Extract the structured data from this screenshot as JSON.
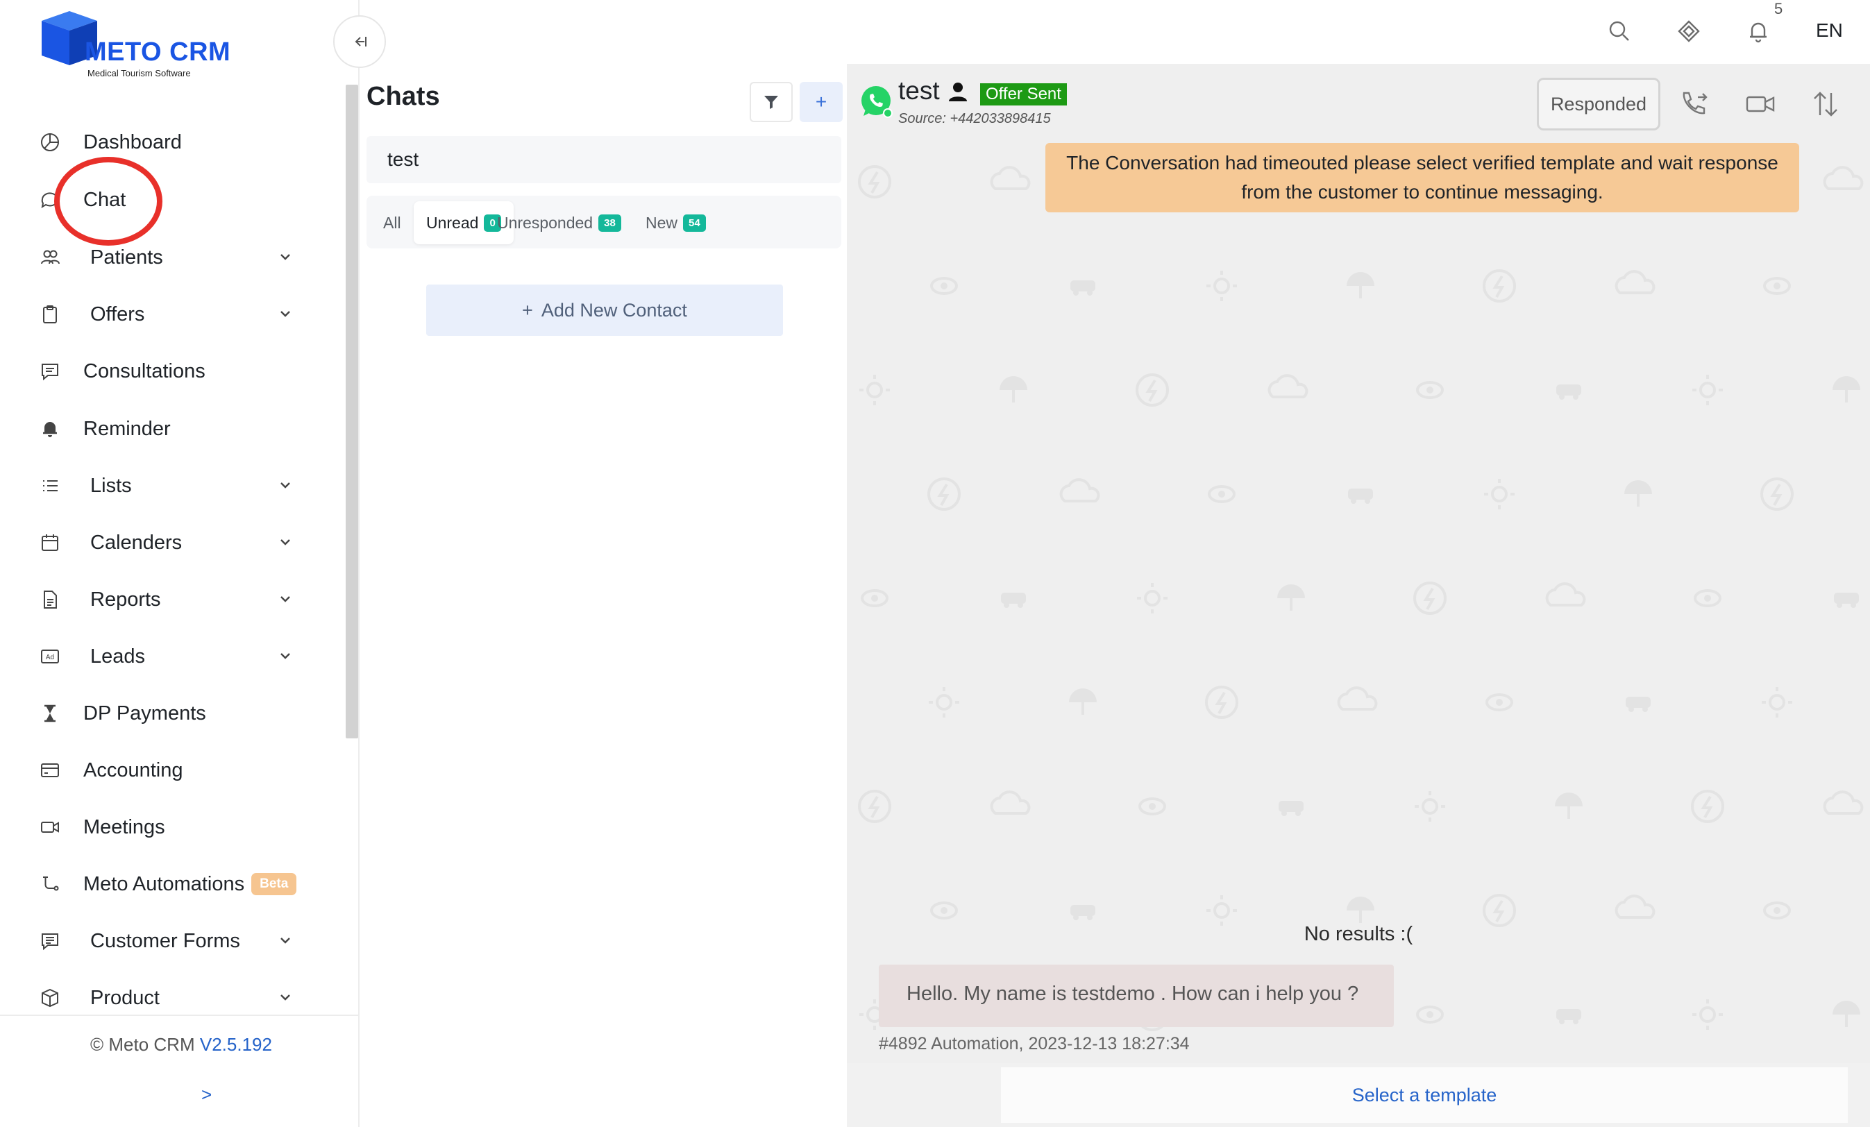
{
  "brand": {
    "name": "METO CRM",
    "tagline": "Medical Tourism Software",
    "color": "#1a55e3"
  },
  "sidebar": {
    "items": [
      {
        "label": "Dashboard",
        "icon": "pie-chart-icon",
        "expandable": false
      },
      {
        "label": "Chat",
        "icon": "chat-bubble-icon",
        "expandable": false,
        "highlighted": true
      },
      {
        "label": "Patients",
        "icon": "users-icon",
        "expandable": true
      },
      {
        "label": "Offers",
        "icon": "clipboard-icon",
        "expandable": true
      },
      {
        "label": "Consultations",
        "icon": "message-square-icon",
        "expandable": false
      },
      {
        "label": "Reminder",
        "icon": "bell-icon",
        "expandable": false
      },
      {
        "label": "Lists",
        "icon": "list-icon",
        "expandable": true
      },
      {
        "label": "Calenders",
        "icon": "calendar-icon",
        "expandable": true
      },
      {
        "label": "Reports",
        "icon": "document-icon",
        "expandable": true
      },
      {
        "label": "Leads",
        "icon": "ad-icon",
        "expandable": true
      },
      {
        "label": "DP Payments",
        "icon": "hourglass-icon",
        "expandable": false
      },
      {
        "label": "Accounting",
        "icon": "credit-card-icon",
        "expandable": false
      },
      {
        "label": "Meetings",
        "icon": "video-icon",
        "expandable": false
      },
      {
        "label": "Meto Automations",
        "icon": "automation-icon",
        "expandable": false,
        "badge": "Beta"
      },
      {
        "label": "Customer Forms",
        "icon": "form-icon",
        "expandable": true
      },
      {
        "label": "Product",
        "icon": "box-icon",
        "expandable": true
      }
    ],
    "footer": {
      "copyright": "© Meto CRM",
      "version": "V2.5.192",
      "expand": ">"
    }
  },
  "topbar": {
    "icons": [
      "search-icon",
      "diamond-icon",
      "bell-icon"
    ],
    "notification_count": "5",
    "language": "EN"
  },
  "chats": {
    "title": "Chats",
    "search_value": "test",
    "tabs": [
      {
        "label": "All",
        "count": null,
        "active": false
      },
      {
        "label": "Unread",
        "count": "0",
        "active": true
      },
      {
        "label": "Unresponded",
        "count": "38",
        "active": false
      },
      {
        "label": "New",
        "count": "54",
        "active": false
      }
    ],
    "add_contact": "Add New Contact",
    "add_contact_prefix": "+",
    "plus_label": "+"
  },
  "conversation": {
    "contact_name": "test",
    "status_badge": "Offer Sent",
    "status_color": "#1d9a14",
    "source": "Source: +442033898415",
    "responded_label": "Responded",
    "timeout_notice": "The Conversation had timeouted please select verified template and wait response from the customer to continue messaging.",
    "no_results": "No results :(",
    "message_text": "Hello. My name is testdemo . How can i help you ?",
    "message_meta": "#4892 Automation, 2023-12-13 18:27:34",
    "template_placeholder": "Select a template",
    "notice_color": "#f6c996",
    "accent": "#2563c9"
  }
}
